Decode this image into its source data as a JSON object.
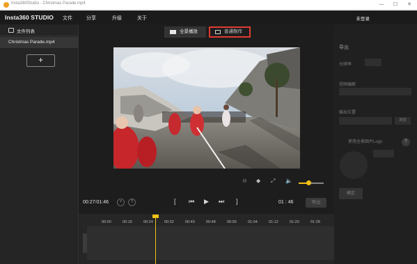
{
  "window": {
    "title": "Insta360Studio - Christmas Parade.mp4",
    "minimize": "—",
    "maximize": "☐",
    "close": "✕"
  },
  "menubar": {
    "logo": "Insta360 STUDIO",
    "items": [
      "文件",
      "分享",
      "升级",
      "关于"
    ],
    "login": "未登录"
  },
  "sidebar": {
    "header": "文件列表",
    "files": [
      "Christmas Parade.mp4"
    ],
    "add_label": "+"
  },
  "modes": {
    "fullscreen_label": "全景播放",
    "immersive_label": "普通制作"
  },
  "controls": {
    "reset_icon": "⊖",
    "gyro_icon": "◆",
    "fullscreen_icon": "⤢",
    "volume_icon": "🔈",
    "volume_level": 0.4
  },
  "transport": {
    "current": "00:27",
    "separator": "/",
    "duration": "01:46",
    "end_time": "01 : 46",
    "export_label": "导出",
    "mark_in": "[",
    "mark_out": "]",
    "prev": "⏮",
    "play": "▶",
    "next": "⏭",
    "bracket_right": "]",
    "add_icon": "+",
    "help_icon": "?"
  },
  "timeline": {
    "ticks": [
      "00:00",
      "00:16",
      "00:24",
      "00:32",
      "00:40",
      "00:48",
      "00:56",
      "01:04",
      "01:12",
      "01:20",
      "01:28"
    ],
    "playhead_time": "00:27"
  },
  "right_panel": {
    "title": "导出",
    "labels": [
      "分辨率",
      "视频编解",
      "输出位置",
      "使用全景图片Logo"
    ],
    "browse": "浏览",
    "help": "?",
    "button": "确定"
  }
}
